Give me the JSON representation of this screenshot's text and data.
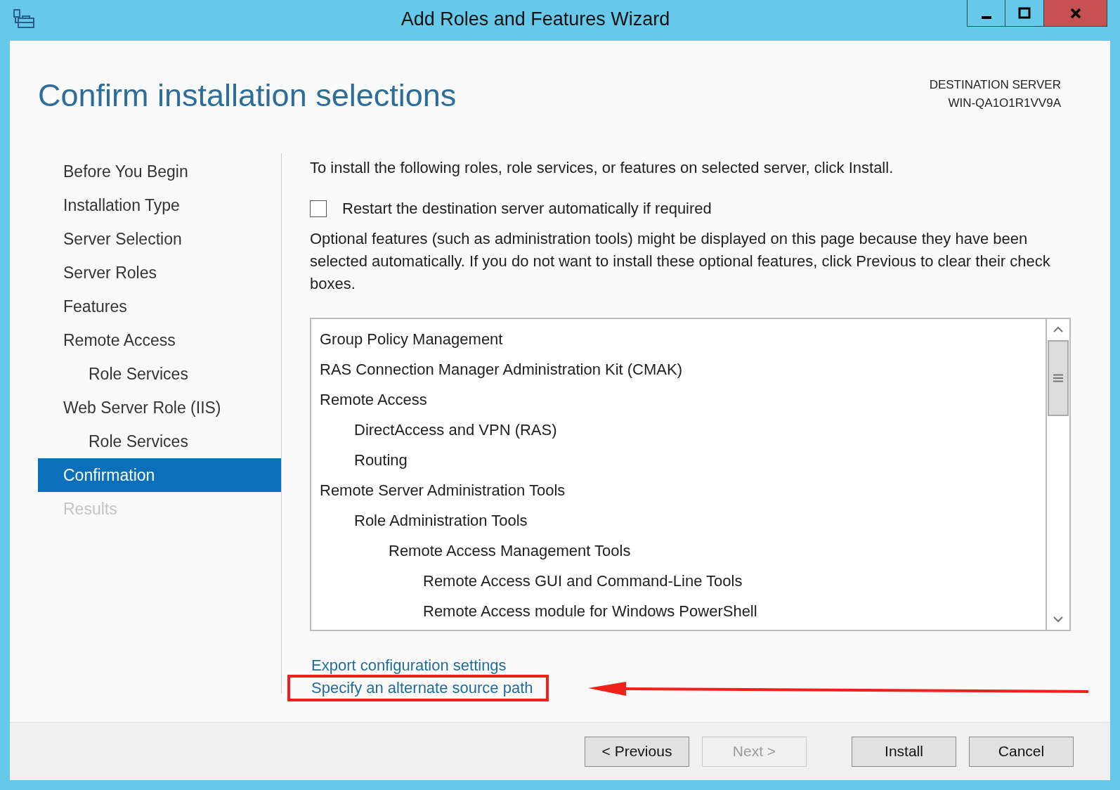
{
  "window": {
    "title": "Add Roles and Features Wizard"
  },
  "page_title": "Confirm installation selections",
  "destination": {
    "label": "DESTINATION SERVER",
    "server": "WIN-QA1O1R1VV9A"
  },
  "steps": [
    {
      "label": "Before You Begin",
      "selected": false,
      "disabled": false
    },
    {
      "label": "Installation Type",
      "selected": false,
      "disabled": false
    },
    {
      "label": "Server Selection",
      "selected": false,
      "disabled": false
    },
    {
      "label": "Server Roles",
      "selected": false,
      "disabled": false
    },
    {
      "label": "Features",
      "selected": false,
      "disabled": false
    },
    {
      "label": "Remote Access",
      "selected": false,
      "disabled": false,
      "children": [
        {
          "label": "Role Services",
          "selected": false,
          "disabled": false
        }
      ]
    },
    {
      "label": "Web Server Role (IIS)",
      "selected": false,
      "disabled": false,
      "children": [
        {
          "label": "Role Services",
          "selected": false,
          "disabled": false
        }
      ]
    },
    {
      "label": "Confirmation",
      "selected": true,
      "disabled": false
    },
    {
      "label": "Results",
      "selected": false,
      "disabled": true
    }
  ],
  "intro": "To install the following roles, role services, or features on selected server, click Install.",
  "restart_checkbox": {
    "label": "Restart the destination server automatically if required",
    "checked": false
  },
  "note": "Optional features (such as administration tools) might be displayed on this page because they have been selected automatically. If you do not want to install these optional features, click Previous to clear their check boxes.",
  "selections": [
    {
      "label": "Group Policy Management"
    },
    {
      "label": "RAS Connection Manager Administration Kit (CMAK)"
    },
    {
      "label": "Remote Access",
      "children": [
        {
          "label": "DirectAccess and VPN (RAS)"
        },
        {
          "label": "Routing"
        }
      ]
    },
    {
      "label": "Remote Server Administration Tools",
      "children": [
        {
          "label": "Role Administration Tools",
          "children": [
            {
              "label": "Remote Access Management Tools",
              "children": [
                {
                  "label": "Remote Access GUI and Command-Line Tools"
                },
                {
                  "label": "Remote Access module for Windows PowerShell"
                }
              ]
            }
          ]
        }
      ]
    }
  ],
  "links": [
    {
      "label": "Export configuration settings",
      "highlighted": false
    },
    {
      "label": "Specify an alternate source path",
      "highlighted": true
    }
  ],
  "buttons": [
    {
      "label": "< Previous",
      "disabled": false
    },
    {
      "label": "Next >",
      "disabled": true
    },
    {
      "label": "Install",
      "disabled": false
    },
    {
      "label": "Cancel",
      "disabled": false
    }
  ]
}
